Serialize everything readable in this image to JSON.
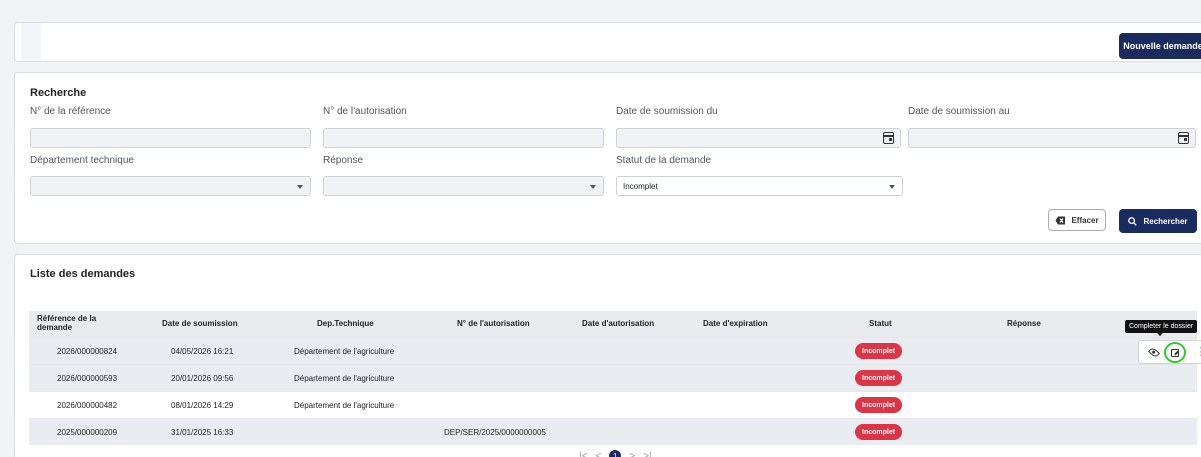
{
  "header": {
    "new_request_label": "Nouvelle demande"
  },
  "search": {
    "title": "Recherche",
    "ref_label": "N° de la référence",
    "auth_label": "N° de l'autorisation",
    "date_from_label": "Date de soumission du",
    "date_to_label": "Date de soumission au",
    "dept_label": "Département technique",
    "response_label": "Réponse",
    "status_label": "Statut de la demande",
    "status_value": "Incomplet",
    "clear_label": "Effacer",
    "search_label": "Rechercher"
  },
  "list": {
    "title": "Liste des demandes",
    "columns": [
      "Référence de la demande",
      "Date de soumission",
      "Dep.Technique",
      "N° de l'autorisation",
      "Date d'autorisation",
      "Date d'expiration",
      "Statut",
      "Réponse"
    ],
    "rows": [
      {
        "ref": "2026/000000824",
        "date": "04/05/2026 16:21",
        "dept": "Département de l'agriculture",
        "auth": "",
        "status": "Incomplet"
      },
      {
        "ref": "2026/000000593",
        "date": "20/01/2026 09:56",
        "dept": "Département de l'agriculture",
        "auth": "",
        "status": "Incomplet"
      },
      {
        "ref": "2026/000000482",
        "date": "08/01/2026 14:29",
        "dept": "Département de l'agriculture",
        "auth": "",
        "status": "Incomplet"
      },
      {
        "ref": "2025/000000209",
        "date": "31/01/2025 16:33",
        "dept": "",
        "auth": "DEP/SER/2025/0000000005",
        "status": "Incomplet"
      }
    ],
    "tooltip": "Completer le dossier",
    "current_page": "1"
  },
  "icons": {
    "calendar": "calendar-icon",
    "caret": "chevron-down-icon",
    "view": "eye-icon",
    "edit": "edit-icon",
    "more": "more-vertical-icon",
    "clear": "close-icon",
    "search": "search-icon"
  },
  "colors": {
    "primary": "#1a2b5f",
    "danger": "#dc3545",
    "highlight_ring": "#32c832"
  }
}
